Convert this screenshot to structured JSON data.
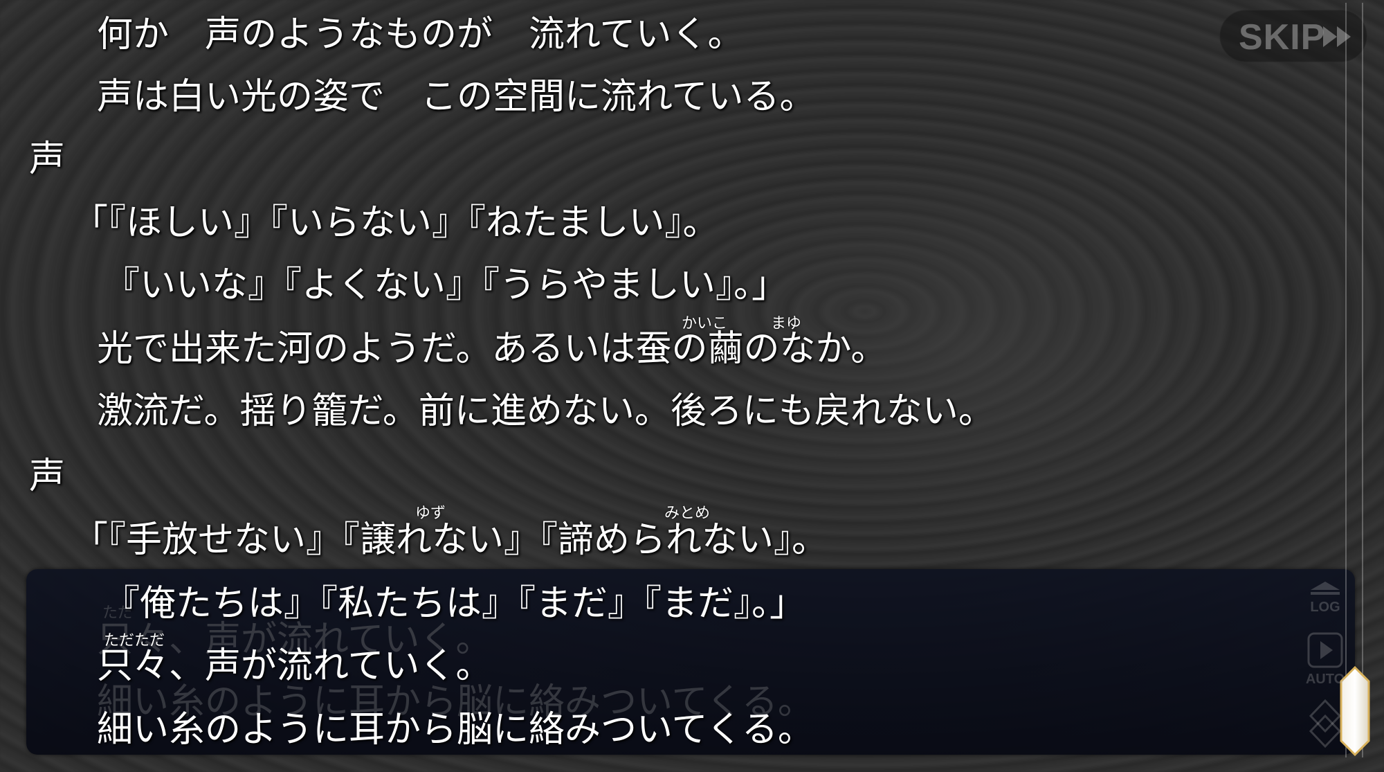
{
  "skip": {
    "label": "SKIP"
  },
  "log_lines": [
    {
      "text": "何か　声のようなものが　流れていく。"
    },
    {
      "text": "声は白い光の姿で　この空間に流れている。"
    },
    {
      "speaker": "声"
    },
    {
      "text": "「『ほしい』『いらない』『ねたましい』。"
    },
    {
      "text": "『いいな』『よくない』『うらやましい』。」"
    },
    {
      "text": "光で出来た河のようだ。あるいは蚕の繭のなか。",
      "ruby": [
        "かいこ",
        "まゆ"
      ]
    },
    {
      "text": "激流だ。揺り籠だ。前に進めない。後ろにも戻れない。"
    },
    {
      "speaker": "声"
    },
    {
      "text": "「『手放せない』『譲れない』『諦められない』。",
      "ruby": [
        "ゆず",
        "みとめ"
      ]
    }
  ],
  "dialogue": {
    "lines": [
      "『俺たちは』『私たちは』『まだ』『まだ』。」",
      "只々、声が流れていく。",
      "細い糸のように耳から脳に絡みついてくる。"
    ],
    "ruby": "ただただ",
    "ghost_lines": [
      "只々、声が流れていく。",
      "細い糸のように耳から脳に絡みついてくる。"
    ],
    "ghost_ruby": "ただ"
  },
  "side_buttons": {
    "log_label": "LOG",
    "auto_label": "AUTO"
  }
}
